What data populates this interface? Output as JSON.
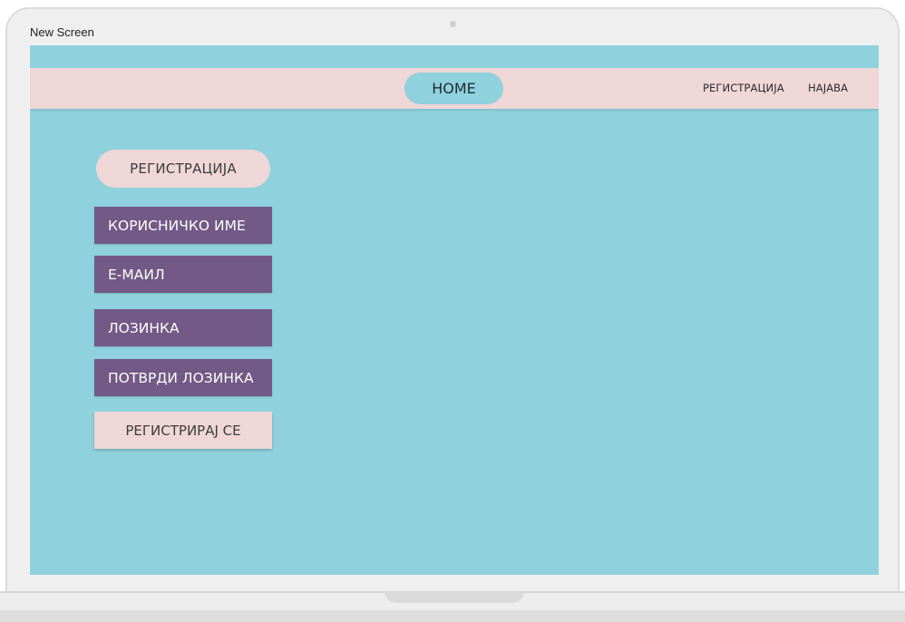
{
  "window": {
    "title": "New Screen"
  },
  "navbar": {
    "home_label": "HOME",
    "register_link": "РЕГИСТРАЦИЈА",
    "login_link": "НАЈАВА"
  },
  "form": {
    "title": "РЕГИСТРАЦИЈА",
    "fields": [
      {
        "placeholder": "КОРИСНИЧКО ИМЕ"
      },
      {
        "placeholder": "Е-МАИЛ"
      },
      {
        "placeholder": "ЛОЗИНКА"
      },
      {
        "placeholder": "ПОТВРДИ ЛОЗИНКА"
      }
    ],
    "submit_label": "РЕГИСТРИРАЈ СЕ"
  },
  "colors": {
    "screen_background": "#8fd1dd",
    "navbar_background": "#efd6d7",
    "field_background": "#725986",
    "button_background": "#efd6d7"
  }
}
